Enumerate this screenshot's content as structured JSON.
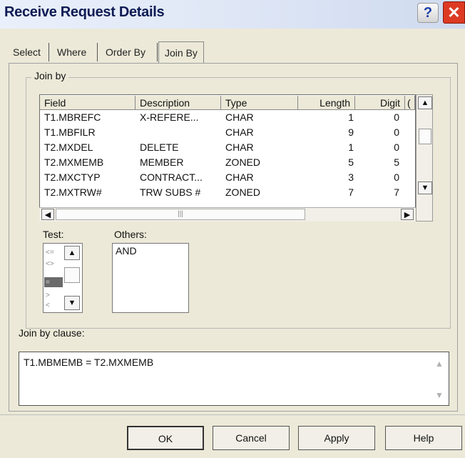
{
  "window": {
    "title": "Receive Request Details",
    "help_label": "?",
    "close_label": "✕"
  },
  "tabs": [
    {
      "label": "Select"
    },
    {
      "label": "Where"
    },
    {
      "label": "Order By"
    },
    {
      "label": "Join By"
    }
  ],
  "join_by": {
    "group_label": "Join by",
    "columns": [
      "Field",
      "Description",
      "Type",
      "Length",
      "Digit",
      "("
    ],
    "rows": [
      {
        "field": "T1.MBREFC",
        "description": "X-REFERE...",
        "type": "CHAR",
        "length": "1",
        "digit": "0"
      },
      {
        "field": "T1.MBFILR",
        "description": "",
        "type": "CHAR",
        "length": "9",
        "digit": "0"
      },
      {
        "field": "T2.MXDEL",
        "description": "DELETE",
        "type": "CHAR",
        "length": "1",
        "digit": "0"
      },
      {
        "field": "T2.MXMEMB",
        "description": "MEMBER",
        "type": "ZONED",
        "length": "5",
        "digit": "5"
      },
      {
        "field": "T2.MXCTYP",
        "description": "CONTRACT...",
        "type": "CHAR",
        "length": "3",
        "digit": "0"
      },
      {
        "field": "T2.MXTRW#",
        "description": "TRW SUBS #",
        "type": "ZONED",
        "length": "7",
        "digit": "7"
      }
    ]
  },
  "test": {
    "label": "Test:",
    "operators": [
      "<=",
      "<>",
      "=",
      ">",
      "<"
    ]
  },
  "others": {
    "label": "Others:",
    "items": [
      "AND"
    ]
  },
  "join_clause": {
    "label": "Join by clause:",
    "value": "T1.MBMEMB = T2.MXMEMB"
  },
  "buttons": {
    "ok": "OK",
    "cancel": "Cancel",
    "apply": "Apply",
    "help": "Help"
  },
  "colors": {
    "close_button": "#dd3a23",
    "title_text": "#0d1b54"
  }
}
